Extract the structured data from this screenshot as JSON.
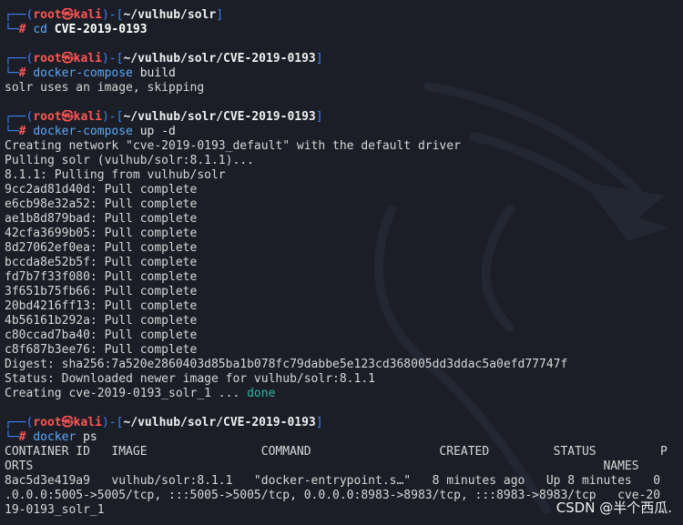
{
  "prompt": {
    "user": "root",
    "skull": "㉿",
    "host": "kali"
  },
  "blocks": [
    {
      "path": "~/vulhub/solr",
      "cmd": "cd",
      "args": "CVE-2019-0193",
      "bold_args": true,
      "output": []
    },
    {
      "path": "~/vulhub/solr/CVE-2019-0193",
      "cmd": "docker-compose",
      "args": "build",
      "bold_args": false,
      "output": [
        "solr uses an image, skipping"
      ]
    },
    {
      "path": "~/vulhub/solr/CVE-2019-0193",
      "cmd": "docker-compose",
      "args": "up -d",
      "bold_args": false,
      "output": [
        "Creating network \"cve-2019-0193_default\" with the default driver",
        "Pulling solr (vulhub/solr:8.1.1)...",
        "8.1.1: Pulling from vulhub/solr",
        "9cc2ad81d40d: Pull complete",
        "e6cb98e32a52: Pull complete",
        "ae1b8d879bad: Pull complete",
        "42cfa3699b05: Pull complete",
        "8d27062ef0ea: Pull complete",
        "bccda8e52b5f: Pull complete",
        "fd7b7f33f080: Pull complete",
        "3f651b75fb66: Pull complete",
        "20bd4216ff13: Pull complete",
        "4b56161b292a: Pull complete",
        "c80ccad7ba40: Pull complete",
        "c8f687b3ee76: Pull complete",
        "Digest: sha256:7a520e2860403d85ba1b078fc79dabbe5e123cd368005dd3ddac5a0efd77747f",
        "Status: Downloaded newer image for vulhub/solr:8.1.1"
      ],
      "final": {
        "text": "Creating cve-2019-0193_solr_1 ... ",
        "status": "done"
      }
    },
    {
      "path": "~/vulhub/solr/CVE-2019-0193",
      "cmd": "docker",
      "args": "ps",
      "bold_args": false,
      "output": [
        "CONTAINER ID   IMAGE                COMMAND                  CREATED         STATUS         P",
        "ORTS                                                                                NAMES",
        "8ac5d3e419a9   vulhub/solr:8.1.1   \"docker-entrypoint.s…\"   8 minutes ago   Up 8 minutes   0",
        ".0.0.0:5005->5005/tcp, :::5005->5005/tcp, 0.0.0.0:8983->8983/tcp, :::8983->8983/tcp   cve-20",
        "19-0193_solr_1"
      ]
    }
  ],
  "watermark": "CSDN @半个西瓜.",
  "colors": {
    "background": "#1b1e26",
    "frame": "#3b82f6",
    "user": "#ff5555",
    "command": "#5fa8f8",
    "done": "#2fb5a8"
  }
}
